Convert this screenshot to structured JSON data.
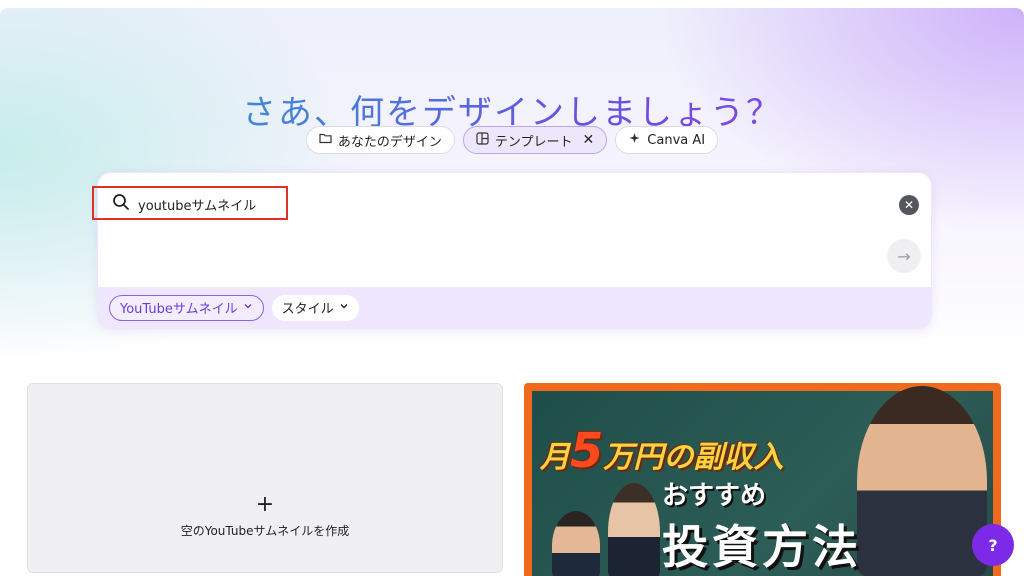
{
  "header": {
    "title": "さあ、何をデザインしましょう？"
  },
  "chips": [
    {
      "label": "あなたのデザイン",
      "icon": "folder-icon"
    },
    {
      "label": "テンプレート",
      "icon": "template-icon",
      "active": true
    },
    {
      "label": "Canva AI",
      "icon": "sparkle-icon"
    }
  ],
  "search": {
    "value": "youtubeサムネイル",
    "clear_symbol": "✕",
    "submit_symbol": "→"
  },
  "filters": [
    {
      "label": "YouTubeサムネイル",
      "selected": true
    },
    {
      "label": "スタイル",
      "selected": false
    }
  ],
  "blank_card": {
    "plus": "+",
    "label": "空のYouTubeサムネイルを作成"
  },
  "template_thumb": {
    "line1_pre": "月",
    "line1_big": "5",
    "line1_post": "万円の副収入",
    "line2": "おすすめ",
    "line3": "投資方法"
  },
  "help": {
    "label": "?"
  },
  "colors": {
    "accent": "#7d2ae8",
    "highlight": "#e0302a",
    "filter_bar": "#efe7fd"
  }
}
